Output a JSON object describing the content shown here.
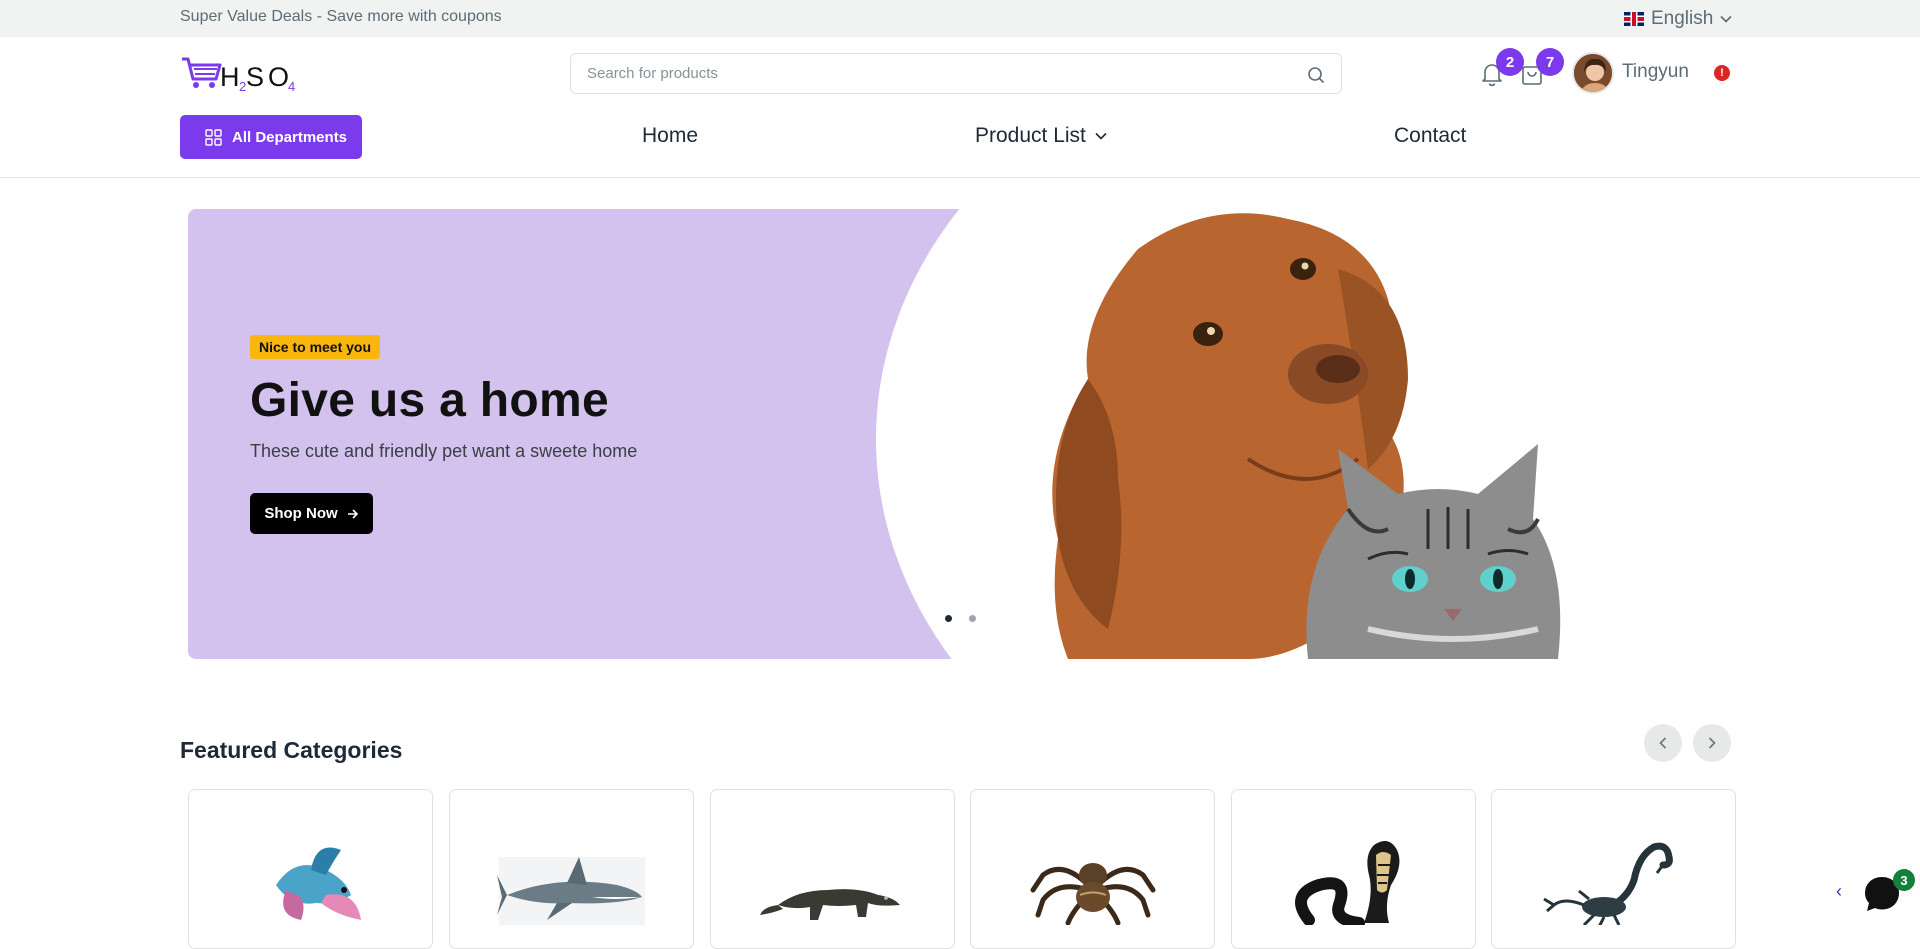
{
  "topbar": {
    "deal_text": "Super Value Deals - Save more with coupons",
    "language": "English"
  },
  "header": {
    "logo_text": "H2SO4",
    "search_placeholder": "Search for products",
    "notifications_count": "2",
    "cart_count": "7",
    "user_name": "Tingyun",
    "alert_symbol": "!"
  },
  "nav": {
    "departments_label": "All Departments",
    "items": [
      {
        "label": "Home"
      },
      {
        "label": "Product List"
      },
      {
        "label": "Contact"
      }
    ]
  },
  "hero": {
    "tag": "Nice to meet you",
    "title": "Give us a home",
    "subtitle": "These cute and friendly pet want a sweete home",
    "button_label": "Shop Now",
    "slide_count": 2,
    "active_slide": 1,
    "background_color": "#d3c2ee"
  },
  "featured": {
    "title": "Featured Categories",
    "categories": [
      {
        "icon": "betta-fish-icon"
      },
      {
        "icon": "shark-icon"
      },
      {
        "icon": "komodo-dragon-icon"
      },
      {
        "icon": "tarantula-icon"
      },
      {
        "icon": "cobra-icon"
      },
      {
        "icon": "scorpion-icon"
      }
    ]
  },
  "chat": {
    "unread_count": "3"
  },
  "colors": {
    "accent": "#7c3aed",
    "tag_yellow": "#f9b60c"
  }
}
